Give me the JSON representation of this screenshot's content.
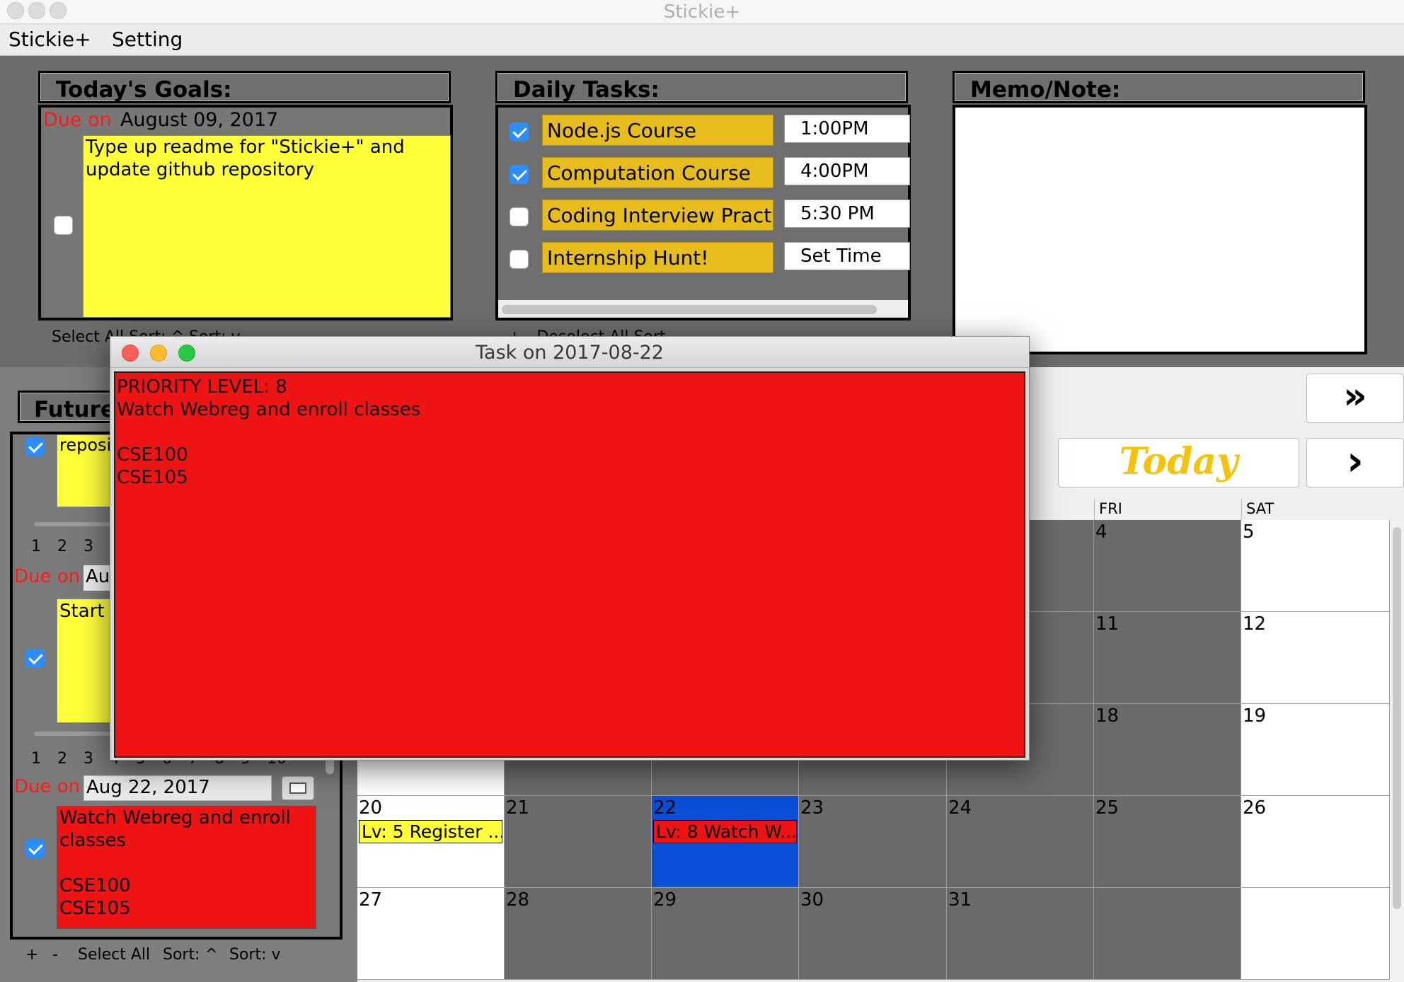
{
  "window": {
    "title": "Stickie+"
  },
  "menu": {
    "items": [
      "Stickie+",
      "Setting"
    ]
  },
  "goals": {
    "header": "Today's Goals:",
    "due_label": "Due on",
    "due_date": "August 09, 2017",
    "note_text": "Type up readme for \"Stickie+\" and\nupdate github repository",
    "checked": false,
    "footer": "Select All   Sort: ^   Sort: v"
  },
  "daily": {
    "header": "Daily Tasks:",
    "tasks": [
      {
        "name": "Node.js Course",
        "time": "1:00PM",
        "checked": true
      },
      {
        "name": "Computation Course",
        "time": "4:00PM",
        "checked": true
      },
      {
        "name": "Coding Interview Practice",
        "time": "5:30 PM",
        "checked": false
      },
      {
        "name": "Internship Hunt!",
        "time": "Set Time",
        "checked": false
      }
    ],
    "footer": "+   -   Deselect All   Sort"
  },
  "memo": {
    "header": "Memo/Note:",
    "text": ""
  },
  "future": {
    "header": "Future",
    "stub1_text": "reposi",
    "priority_numbers": [
      "1",
      "2",
      "3",
      "4",
      "5",
      "6",
      "7",
      "8",
      "9",
      "10"
    ],
    "due_label": "Due on",
    "stub2_date": "Au",
    "stub2_text": "Start I",
    "item3_date": "Aug 22, 2017",
    "item3_text": "Watch Webreg and enroll\nclasses\n\nCSE100\nCSE105",
    "footer": {
      "plus": "+",
      "minus": "-",
      "select_all": "Select All",
      "sort_up": "Sort: ^",
      "sort_down": "Sort: v"
    }
  },
  "calendar": {
    "next_month_label": "»",
    "today_label": "Today",
    "next_label": "›",
    "day_headers": [
      "FRI",
      "SAT"
    ],
    "rows": [
      [
        "",
        "",
        "",
        "",
        "",
        "4",
        "5"
      ],
      [
        "",
        "",
        "",
        "",
        "",
        "11",
        "12"
      ],
      [
        "",
        "",
        "",
        "",
        "",
        "18",
        "19"
      ],
      [
        "20",
        "21",
        "22",
        "23",
        "24",
        "25",
        "26"
      ],
      [
        "27",
        "28",
        "29",
        "30",
        "31",
        "",
        ""
      ]
    ],
    "events": [
      {
        "day": "20",
        "text": "Lv: 5 Register ...",
        "color": "#ffff3a"
      },
      {
        "day": "22",
        "text": "Lv: 8 Watch W...",
        "color": "#ee1414"
      }
    ],
    "selected_day": "22",
    "selected_color": "#0a4fd6"
  },
  "popup": {
    "title": "Task on 2017-08-22",
    "body": "PRIORITY LEVEL: 8\nWatch Webreg and enroll classes\n\nCSE100\nCSE105"
  },
  "colors": {
    "note_yellow": "#ffff3a",
    "task_gold": "#e7bd1e",
    "priority_red": "#ee1414",
    "check_blue": "#2d8dfb"
  }
}
